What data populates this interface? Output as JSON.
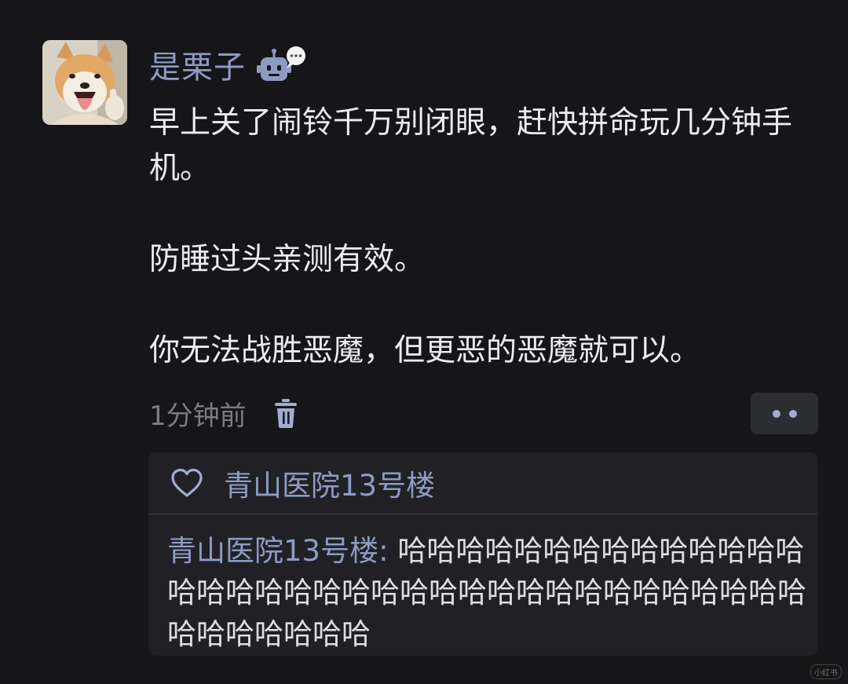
{
  "post": {
    "username": "是栗子",
    "badge_icon": "bot-chat-icon",
    "paragraphs": [
      "早上关了闹铃千万别闭眼，赶快拼命玩几分钟手机。",
      "防睡过头亲测有效。",
      "你无法战胜恶魔，但更恶的恶魔就可以。"
    ],
    "timestamp": "1分钟前",
    "delete_icon": "trash-icon",
    "more_icon": "more-dots-icon"
  },
  "reply_card": {
    "like_icon": "heart-outline-icon",
    "liker_name": "青山医院13号楼",
    "comment": {
      "author": "青山医院13号楼",
      "separator": ": ",
      "text": "哈哈哈哈哈哈哈哈哈哈哈哈哈哈哈哈哈哈哈哈哈哈哈哈哈哈哈哈哈哈哈哈哈哈哈哈哈哈哈哈哈哈哈"
    }
  },
  "watermark": "小红书",
  "colors": {
    "background": "#161618",
    "accent_name": "#8d9bc4",
    "body_text": "#ececee",
    "muted_text": "#7b7c80",
    "card_bg": "#212125"
  }
}
